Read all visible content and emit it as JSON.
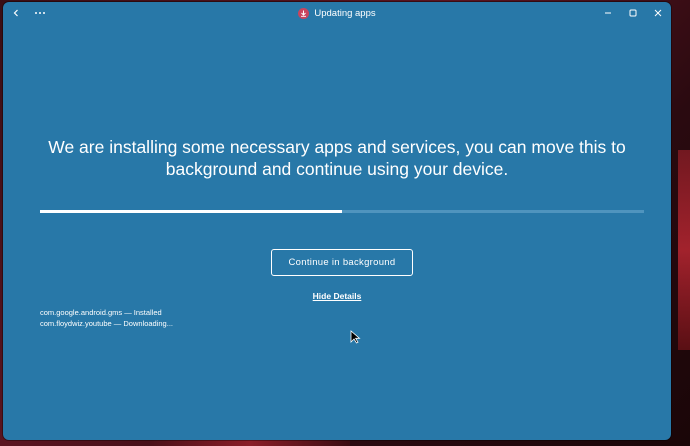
{
  "window": {
    "title": "Updating apps",
    "back_icon": "back-arrow-icon",
    "menu_icon": "more-dots-icon",
    "app_icon": "download-icon",
    "controls": [
      "minimize-icon",
      "maximize-icon",
      "close-icon"
    ]
  },
  "main": {
    "headline": "We are installing some necessary apps and services, you can move this to background and continue using your device.",
    "progress_fraction": 0.5,
    "continue_label": "Continue in background",
    "hide_details_label": "Hide Details",
    "details": [
      "com.google.android.gms — Installed",
      "com.floydwiz.youtube — Downloading..."
    ]
  },
  "colors": {
    "window_bg": "#2878a8",
    "progress_track": "#4f94be",
    "progress_fill": "#ffffff",
    "text": "#ffffff",
    "app_icon_bg": "#c9455e"
  }
}
